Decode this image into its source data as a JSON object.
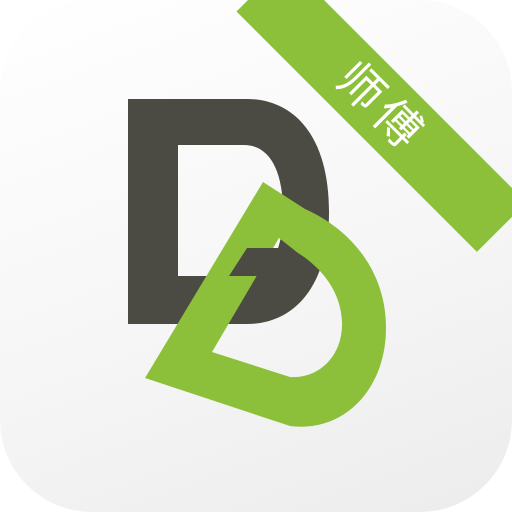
{
  "badge": {
    "label": "师傅"
  },
  "colors": {
    "brand_green": "#8cc03a",
    "dark_letter": "#4b4b43",
    "tile_background": "#f4f4f4"
  },
  "icons": {
    "logo": "dd-monogram-logo-icon"
  }
}
